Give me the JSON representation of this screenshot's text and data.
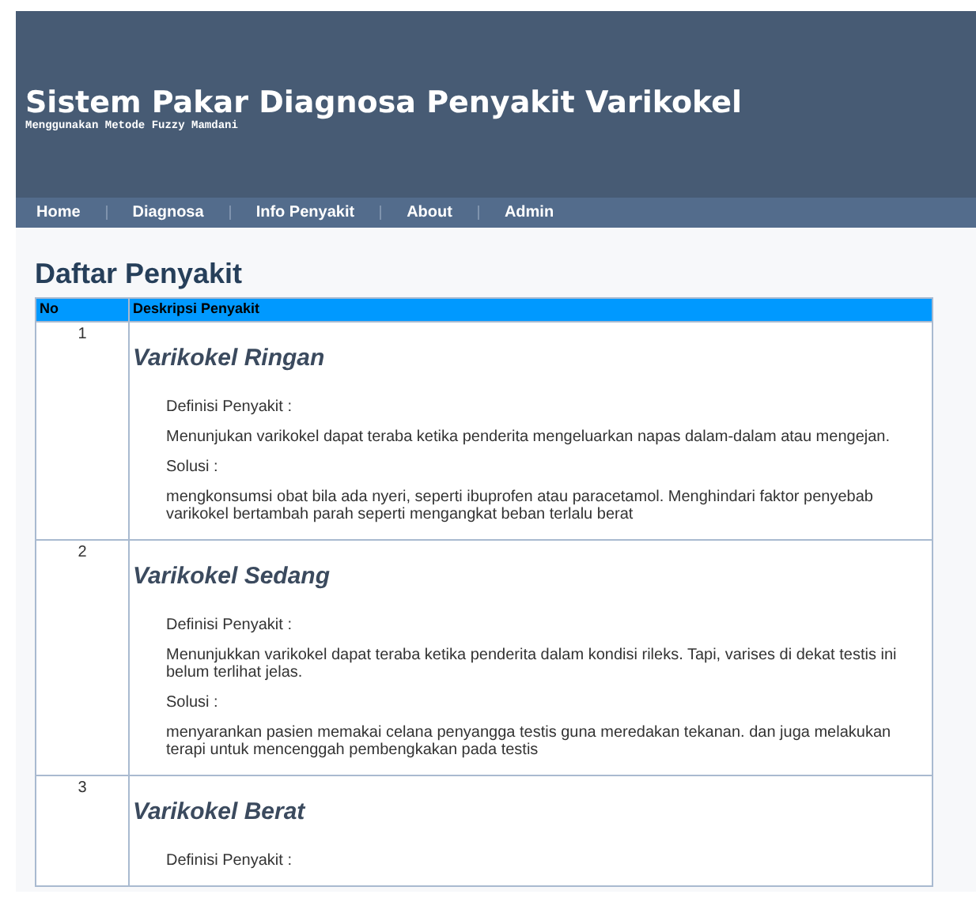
{
  "header": {
    "title": "Sistem Pakar Diagnosa Penyakit Varikokel",
    "subtitle": "Menggunakan Metode Fuzzy Mamdani"
  },
  "nav": [
    {
      "label": "Home"
    },
    {
      "label": "Diagnosa"
    },
    {
      "label": "Info Penyakit"
    },
    {
      "label": "About"
    },
    {
      "label": "Admin"
    }
  ],
  "page_title": "Daftar Penyakit",
  "table": {
    "columns": [
      "No",
      "Deskripsi Penyakit"
    ],
    "rows": [
      {
        "no": "1",
        "name": "Varikokel Ringan",
        "definition_label": "Definisi Penyakit :",
        "definition": "Menunjukan varikokel dapat teraba ketika penderita mengeluarkan napas dalam-dalam atau mengejan.",
        "solution_label": "Solusi :",
        "solution": "mengkonsumsi obat bila ada nyeri, seperti ibuprofen atau paracetamol. Menghindari faktor penyebab varikokel bertambah parah seperti mengangkat beban terlalu berat"
      },
      {
        "no": "2",
        "name": "Varikokel Sedang",
        "definition_label": "Definisi Penyakit :",
        "definition": "Menunjukkan varikokel dapat teraba ketika penderita dalam kondisi rileks. Tapi, varises di dekat testis ini belum terlihat jelas.",
        "solution_label": "Solusi :",
        "solution": "menyarankan pasien memakai celana penyangga testis guna meredakan tekanan. dan juga melakukan terapi untuk mencenggah pembengkakan pada testis"
      },
      {
        "no": "3",
        "name": "Varikokel Berat",
        "definition_label": "Definisi Penyakit :"
      }
    ]
  }
}
